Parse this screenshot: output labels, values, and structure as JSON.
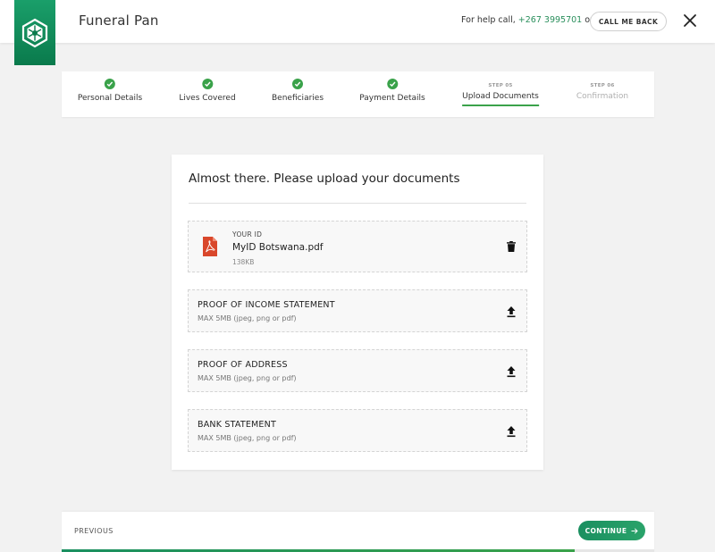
{
  "header": {
    "title": "Funeral Pan",
    "help_text": "For help call,",
    "help_phone": "+267 3995701",
    "help_or": "or",
    "callback_label": "CALL ME BACK"
  },
  "stepper": {
    "steps": [
      {
        "label": "Personal Details",
        "status": "complete"
      },
      {
        "label": "Lives Covered",
        "status": "complete"
      },
      {
        "label": "Beneficiaries",
        "status": "complete"
      },
      {
        "label": "Payment Details",
        "status": "complete"
      },
      {
        "label": "Upload Documents",
        "step_number": "STEP 05",
        "status": "active"
      },
      {
        "label": "Confirmation",
        "step_number": "STEP 06",
        "status": "upcoming"
      }
    ]
  },
  "card": {
    "title": "Almost there. Please upload your documents",
    "uploaded": {
      "label": "YOUR ID",
      "file_name": "MyID Botswana.pdf",
      "file_size": "138KB"
    },
    "documents": [
      {
        "label": "PROOF OF INCOME STATEMENT",
        "hint": "MAX 5MB (jpeg, png or pdf)"
      },
      {
        "label": "PROOF OF ADDRESS",
        "hint": "MAX 5MB (jpeg, png or pdf)"
      },
      {
        "label": "BANK STATEMENT",
        "hint": "MAX 5MB (jpeg, png or pdf)"
      }
    ]
  },
  "footer": {
    "previous_label": "PREVIOUS",
    "continue_label": "CONTINUE",
    "progress_fraction": 0.866
  },
  "colors": {
    "brand_green": "#1a8f60",
    "check_green": "#3aa24a",
    "phone_green": "#2a8f5c",
    "pdf_red": "#d9472b"
  },
  "icons": [
    "logo-icon",
    "close-icon",
    "check-icon",
    "pdf-icon",
    "trash-icon",
    "upload-icon",
    "arrow-right-icon"
  ]
}
